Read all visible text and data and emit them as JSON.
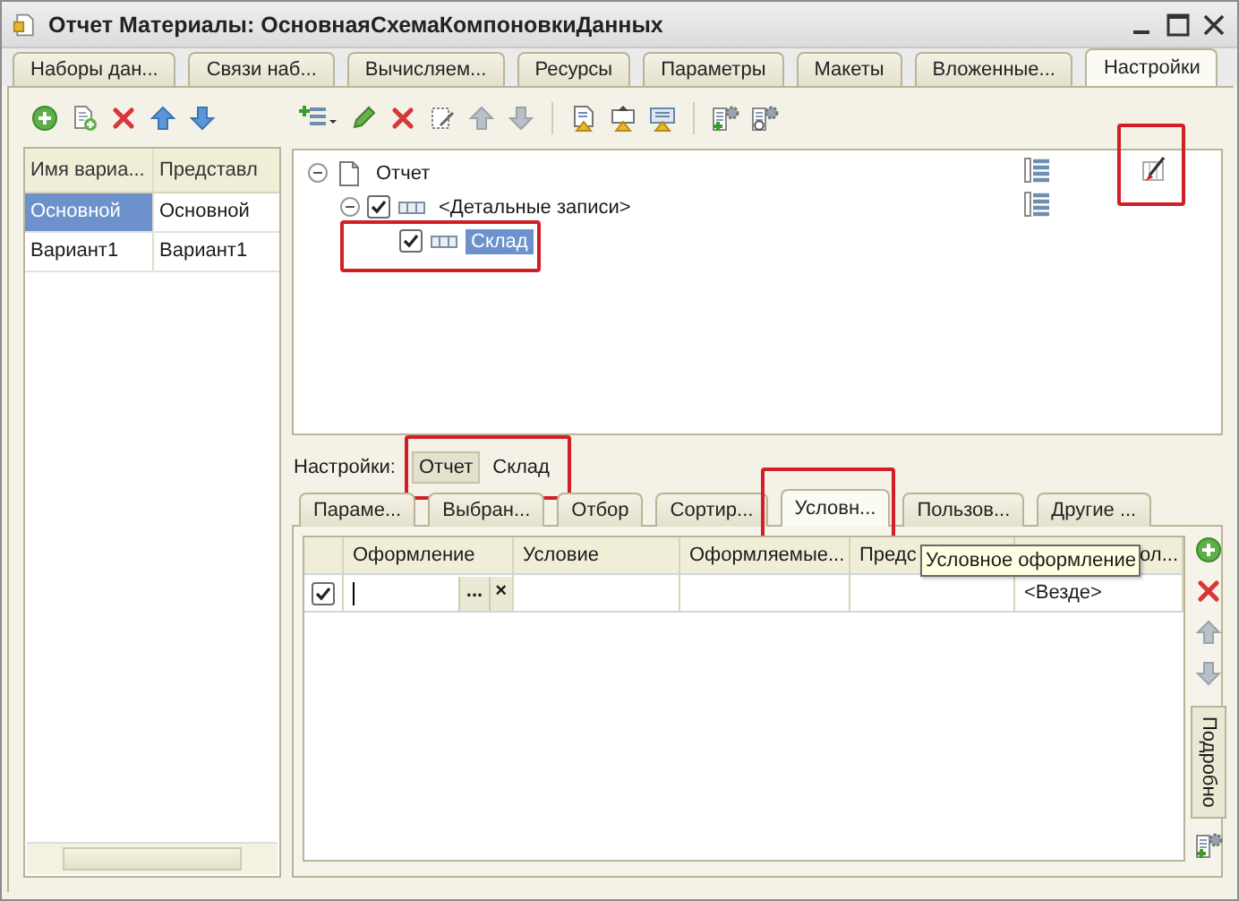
{
  "window": {
    "title": "Отчет Материалы: ОсновнаяСхемаКомпоновкиДанных"
  },
  "tabs": [
    {
      "label": "Наборы дан...",
      "selected": false
    },
    {
      "label": "Связи наб...",
      "selected": false
    },
    {
      "label": "Вычисляем...",
      "selected": false
    },
    {
      "label": "Ресурсы",
      "selected": false
    },
    {
      "label": "Параметры",
      "selected": false
    },
    {
      "label": "Макеты",
      "selected": false
    },
    {
      "label": "Вложенные...",
      "selected": false
    },
    {
      "label": "Настройки",
      "selected": true
    }
  ],
  "variants": {
    "columns": [
      "Имя вариа...",
      "Представл"
    ],
    "rows": [
      {
        "cells": [
          "Основной",
          "Основной"
        ],
        "selected": true
      },
      {
        "cells": [
          "Вариант1",
          "Вариант1"
        ],
        "selected": false
      }
    ]
  },
  "structure": {
    "items": [
      {
        "kind": "report",
        "label": "Отчет",
        "expanded": true,
        "selected": false,
        "highlighted": false,
        "children": [
          {
            "kind": "grouping",
            "label": "<Детальные записи>",
            "checked": true,
            "expanded": true,
            "selected": false,
            "highlighted": false,
            "children": [
              {
                "kind": "grouping",
                "label": "Склад",
                "checked": true,
                "selected": true,
                "highlighted": true
              }
            ]
          }
        ]
      }
    ]
  },
  "conditional_appearance_button": {
    "highlighted": true
  },
  "settings_for": {
    "label": "Настройки:",
    "highlighted": true,
    "options": [
      {
        "label": "Отчет",
        "selected": true
      },
      {
        "label": "Склад",
        "selected": false
      }
    ]
  },
  "inner_tabs": [
    {
      "label": "Параме...",
      "selected": false,
      "highlighted": false
    },
    {
      "label": "Выбран...",
      "selected": false,
      "highlighted": false
    },
    {
      "label": "Отбор",
      "selected": false,
      "highlighted": false
    },
    {
      "label": "Сортир...",
      "selected": false,
      "highlighted": false
    },
    {
      "label": "Условн...",
      "selected": true,
      "highlighted": true
    },
    {
      "label": "Пользов...",
      "selected": false,
      "highlighted": false
    },
    {
      "label": "Другие ...",
      "selected": false,
      "highlighted": false
    }
  ],
  "grid": {
    "columns": [
      "Оформление",
      "Условие",
      "Оформляемые...",
      "Предс",
      "ол..."
    ],
    "rows": [
      {
        "checked": true,
        "editing": true,
        "choice_button": "...",
        "clear_button": "×",
        "column_5": "<Везде>"
      }
    ]
  },
  "tooltip": "Условное оформление",
  "details_button": "Подробно"
}
